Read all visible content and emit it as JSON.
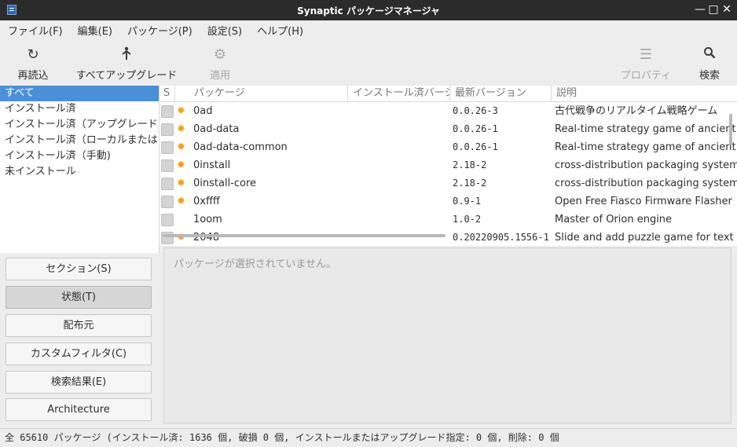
{
  "window": {
    "title": "Synaptic パッケージマネージャ"
  },
  "menubar": [
    "ファイル(F)",
    "編集(E)",
    "パッケージ(P)",
    "設定(S)",
    "ヘルプ(H)"
  ],
  "toolbar": {
    "reload": {
      "label": "再読込",
      "icon": "reload-icon"
    },
    "upgrade_all": {
      "label": "すべてアップグレード",
      "icon": "upgrade-icon"
    },
    "apply": {
      "label": "適用",
      "icon": "apply-icon",
      "disabled": true
    },
    "properties": {
      "label": "プロパティ",
      "icon": "properties-icon",
      "disabled": true
    },
    "search": {
      "label": "検索",
      "icon": "search-icon"
    }
  },
  "filters": {
    "items": [
      "すべて",
      "インストール済",
      "インストール済（アップグレード",
      "インストール済（ローカルまたは",
      "インストール済（手動)",
      "未インストール"
    ],
    "selected_index": 0
  },
  "filter_buttons": [
    "セクション(S)",
    "状態(T)",
    "配布元",
    "カスタムフィルタ(C)",
    "検索結果(E)",
    "Architecture"
  ],
  "active_filter_button": 1,
  "table": {
    "headers": {
      "status": "S",
      "package": "パッケージ",
      "installed": "インストール済バージョン",
      "latest": "最新バージョン",
      "description": "説明"
    },
    "rows": [
      {
        "name": "0ad",
        "installed": "",
        "latest": "0.0.26-3",
        "desc": "古代戦争のリアルタイム戦略ゲーム",
        "supported": true
      },
      {
        "name": "0ad-data",
        "installed": "",
        "latest": "0.0.26-1",
        "desc": "Real-time strategy game of ancient warfare (data files)",
        "supported": true
      },
      {
        "name": "0ad-data-common",
        "installed": "",
        "latest": "0.0.26-1",
        "desc": "Real-time strategy game of ancient warfare (common data files)",
        "supported": true
      },
      {
        "name": "0install",
        "installed": "",
        "latest": "2.18-2",
        "desc": "cross-distribution packaging system",
        "supported": true
      },
      {
        "name": "0install-core",
        "installed": "",
        "latest": "2.18-2",
        "desc": "cross-distribution packaging system (core)",
        "supported": true
      },
      {
        "name": "0xffff",
        "installed": "",
        "latest": "0.9-1",
        "desc": "Open Free Fiasco Firmware Flasher",
        "supported": true
      },
      {
        "name": "1oom",
        "installed": "",
        "latest": "1.0-2",
        "desc": "Master of Orion engine",
        "supported": false
      },
      {
        "name": "2048",
        "installed": "",
        "latest": "0.20220905.1556-1",
        "desc": "Slide and add puzzle game for text mode",
        "supported": true
      }
    ]
  },
  "details": {
    "message": "パッケージが選択されていません。"
  },
  "statusbar": {
    "text": "全 65610 パッケージ (インストール済: 1636 個, 破損 0 個, インストールまたはアップグレード指定: 0 個, 削除: 0 個"
  }
}
